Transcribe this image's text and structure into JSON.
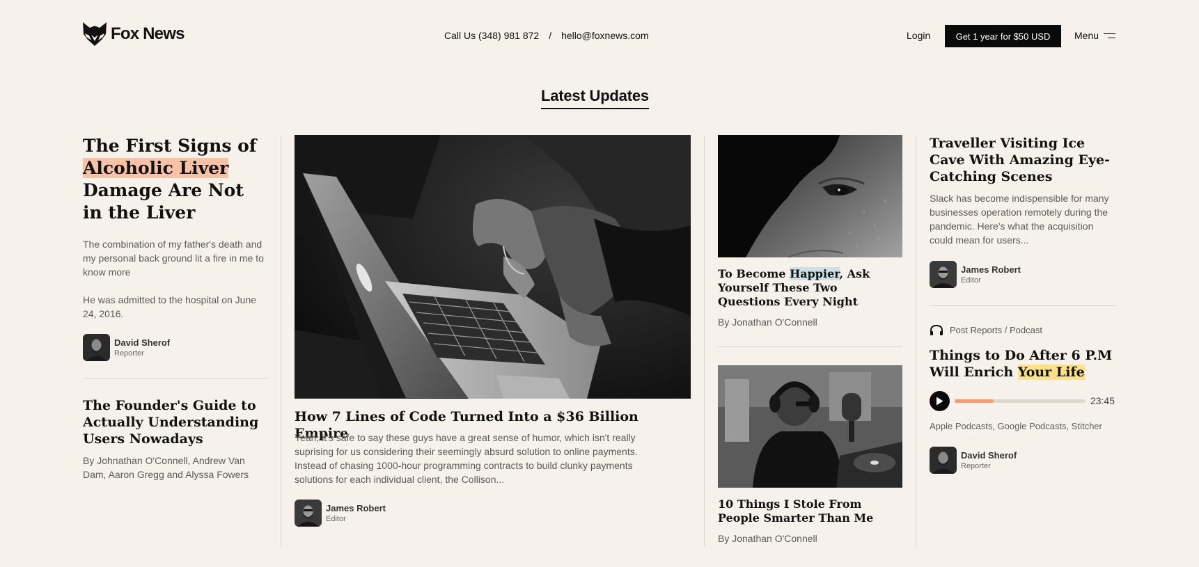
{
  "header": {
    "brand": "Fox News",
    "phone": "Call Us (348) 981 872",
    "separator": "/",
    "email": "hello@foxnews.com",
    "login": "Login",
    "cta": "Get 1 year for $50 USD",
    "menu": "Menu"
  },
  "section_title": "Latest Updates",
  "col1": {
    "title_pre": "The First Signs of",
    "title_hl": "Alcoholic Liver",
    "title_post": "Damage Are Not in the Liver",
    "desc1": "The combination of my father's death and my personal back ground lit a fire in me to know more",
    "desc2": "He was admitted to the hospital on June 24, 2016.",
    "author": {
      "name": "David Sherof",
      "role": "Reporter"
    },
    "title2": "The Founder's Guide to Actually Understanding Users Nowadays",
    "byline2": "By Johnathan O'Connell, Andrew Van Dam, Aaron Gregg and Alyssa Fowers"
  },
  "col2": {
    "title": "How 7 Lines of Code Turned Into a $36 Billion Empire",
    "desc": "Yeah, it's safe to say these guys have a great sense of humor, which isn't really suprising for us considering their seemingly absurd solution to online payments. Instead of chasing 1000-hour programming contracts to build clunky payments solutions for each individual client, the Collison...",
    "author": {
      "name": "James Robert",
      "role": "Editor"
    }
  },
  "col3": {
    "title1_pre": "To Become",
    "title1_hl": "Happier",
    "title1_post": ", Ask Yourself These Two Questions Every Night",
    "byline1": "By Jonathan O'Connell",
    "title2": "10 Things I Stole From People Smarter Than Me",
    "byline2": "By Jonathan O'Connell"
  },
  "col4": {
    "title1": "Traveller Visiting Ice Cave With Amazing Eye-Catching Scenes",
    "desc": "Slack has become indispensible for many businesses operation remotely during the pandemic. Here's what the acquisition could mean for users...",
    "author1": {
      "name": "James Robert",
      "role": "Editor"
    },
    "podcast_category": "Post Reports / Podcast",
    "title2_pre": "Things to Do After 6 P.M Will Enrich",
    "title2_hl": "Your Life",
    "player": {
      "progress": 0.3,
      "duration": "23:45"
    },
    "platforms": "Apple Podcasts, Google Podcasts, Stitcher",
    "author2": {
      "name": "David Sherof",
      "role": "Reporter"
    }
  },
  "colors": {
    "background": "#f6f2eb",
    "peach_highlight": "#f8c2a6",
    "blue_highlight": "#cfe1e6",
    "yellow_highlight": "#fbe287",
    "progress": "#f59a72"
  },
  "icons": [
    "fox-logo-icon",
    "menu-icon",
    "headphones-icon",
    "play-icon"
  ]
}
